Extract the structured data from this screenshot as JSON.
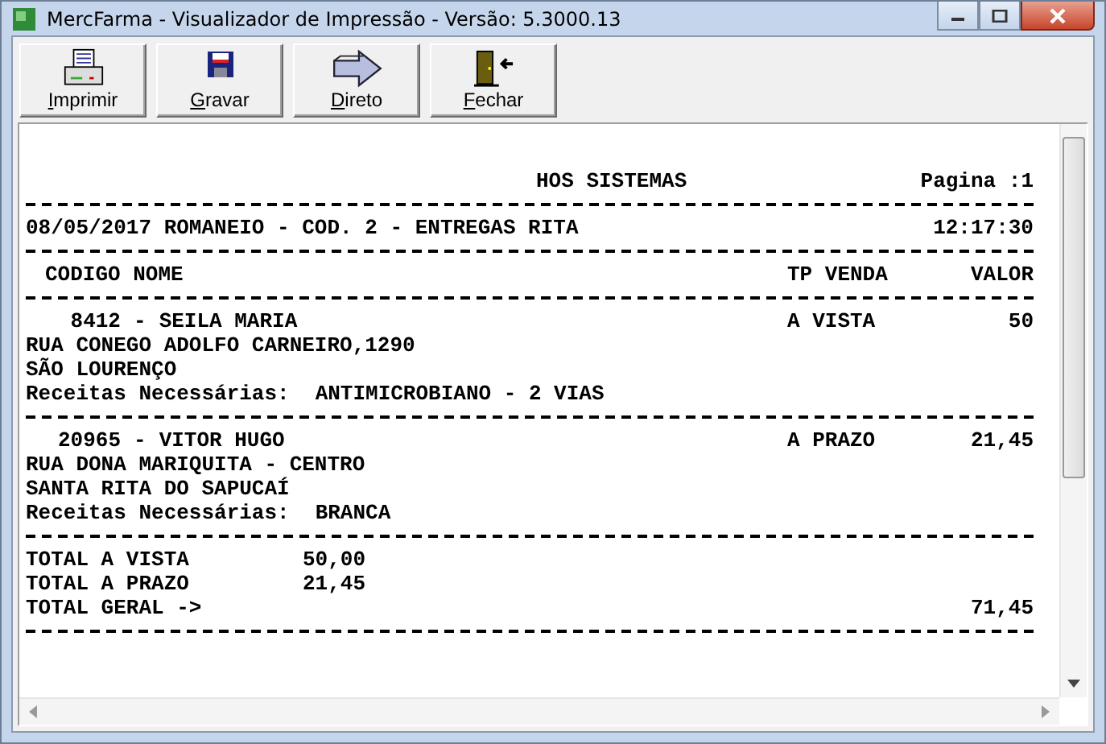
{
  "window": {
    "title": "MercFarma - Visualizador de Impressão - Versão: 5.3000.13"
  },
  "toolbar": [
    {
      "kind": "printer",
      "label": "Imprimir"
    },
    {
      "kind": "disk",
      "label": "Gravar"
    },
    {
      "kind": "arrow",
      "label": "Direto"
    },
    {
      "kind": "door",
      "label": "Fechar"
    }
  ],
  "report": {
    "header": "HOS SISTEMAS",
    "page": "Pagina :1",
    "title": "08/05/2017 ROMANEIO - COD. 2 - ENTREGAS RITA",
    "time": "12:17:30",
    "columns": [
      "CODIGO NOME",
      "TP VENDA",
      "VALOR"
    ],
    "entries": [
      {
        "code": "8412",
        "separator": "-",
        "name": "SEILA MARIA",
        "sale_type": "A VISTA",
        "value": "50",
        "address": "RUA CONEGO ADOLFO CARNEIRO,1290",
        "city": "SÃO LOURENÇO",
        "prescriptions_label": "Receitas Necessárias:",
        "prescriptions": "ANTIMICROBIANO - 2 VIAS"
      },
      {
        "code": "20965",
        "separator": "-",
        "name": "VITOR HUGO",
        "sale_type": "A PRAZO",
        "value": "21,45",
        "address": "RUA DONA MARIQUITA - CENTRO",
        "city": "SANTA RITA DO SAPUCAÍ",
        "prescriptions_label": "Receitas Necessárias:",
        "prescriptions": "BRANCA"
      }
    ],
    "totals": [
      {
        "label": "TOTAL A VISTA",
        "value": "50,00"
      },
      {
        "label": "TOTAL A PRAZO",
        "value": "21,45"
      }
    ],
    "grand_total": {
      "label": "TOTAL GERAL ->",
      "value": "71,45"
    }
  }
}
